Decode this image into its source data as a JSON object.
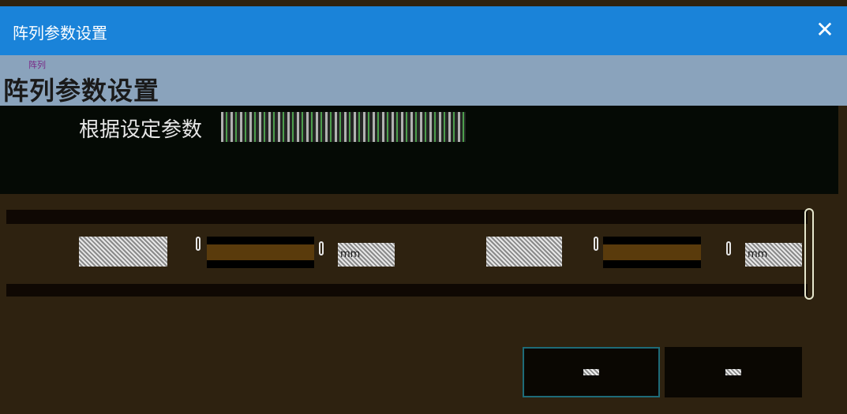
{
  "window": {
    "title": "阵列参数设置",
    "close_glyph": "✕",
    "icon_close": "close-icon"
  },
  "header": {
    "logo_text": "阵列",
    "heading": "阵列参数设置"
  },
  "description": {
    "text": "根据设定参数"
  },
  "params": [
    {
      "label": "",
      "value": "",
      "unit": "mm"
    },
    {
      "label": "",
      "value": "",
      "unit": "mm"
    }
  ],
  "buttons": {
    "ok": "",
    "cancel": ""
  },
  "colors": {
    "titlebar": "#1a83d9",
    "header_band": "#8aa3bc",
    "background": "#2e2210"
  }
}
